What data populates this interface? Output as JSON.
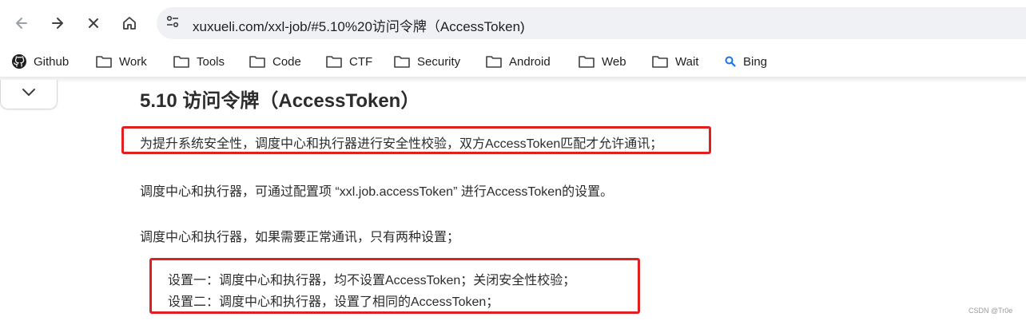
{
  "browser": {
    "url": "xuxueli.com/xxl-job/#5.10%20访问令牌（AccessToken)",
    "back_icon": "arrow-left-icon",
    "forward_icon": "arrow-right-icon",
    "stop_icon": "close-icon",
    "home_icon": "home-icon",
    "site_info_icon": "tune-icon"
  },
  "bookmarks": [
    {
      "label": "Github",
      "icon": "github-icon"
    },
    {
      "label": "Work",
      "icon": "folder-icon"
    },
    {
      "label": "Tools",
      "icon": "folder-icon"
    },
    {
      "label": "Code",
      "icon": "folder-icon"
    },
    {
      "label": "CTF",
      "icon": "folder-icon"
    },
    {
      "label": "Security",
      "icon": "folder-icon"
    },
    {
      "label": "Android",
      "icon": "folder-icon"
    },
    {
      "label": "Web",
      "icon": "folder-icon"
    },
    {
      "label": "Wait",
      "icon": "folder-icon"
    },
    {
      "label": "Bing",
      "icon": "search-icon"
    }
  ],
  "content": {
    "heading": "5.10 访问令牌（AccessToken）",
    "para1": "为提升系统安全性，调度中心和执行器进行安全性校验，双方AccessToken匹配才允许通讯；",
    "para2": "调度中心和执行器，可通过配置项 “xxl.job.accessToken” 进行AccessToken的设置。",
    "para3": "调度中心和执行器，如果需要正常通讯，只有两种设置；",
    "option1": "设置一：调度中心和执行器，均不设置AccessToken；关闭安全性校验；",
    "option2": "设置二：调度中心和执行器，设置了相同的AccessToken；"
  },
  "watermark": "CSDN @Tr0e",
  "colors": {
    "highlight_box": "#e02020",
    "bing_icon": "#1a73e8"
  }
}
